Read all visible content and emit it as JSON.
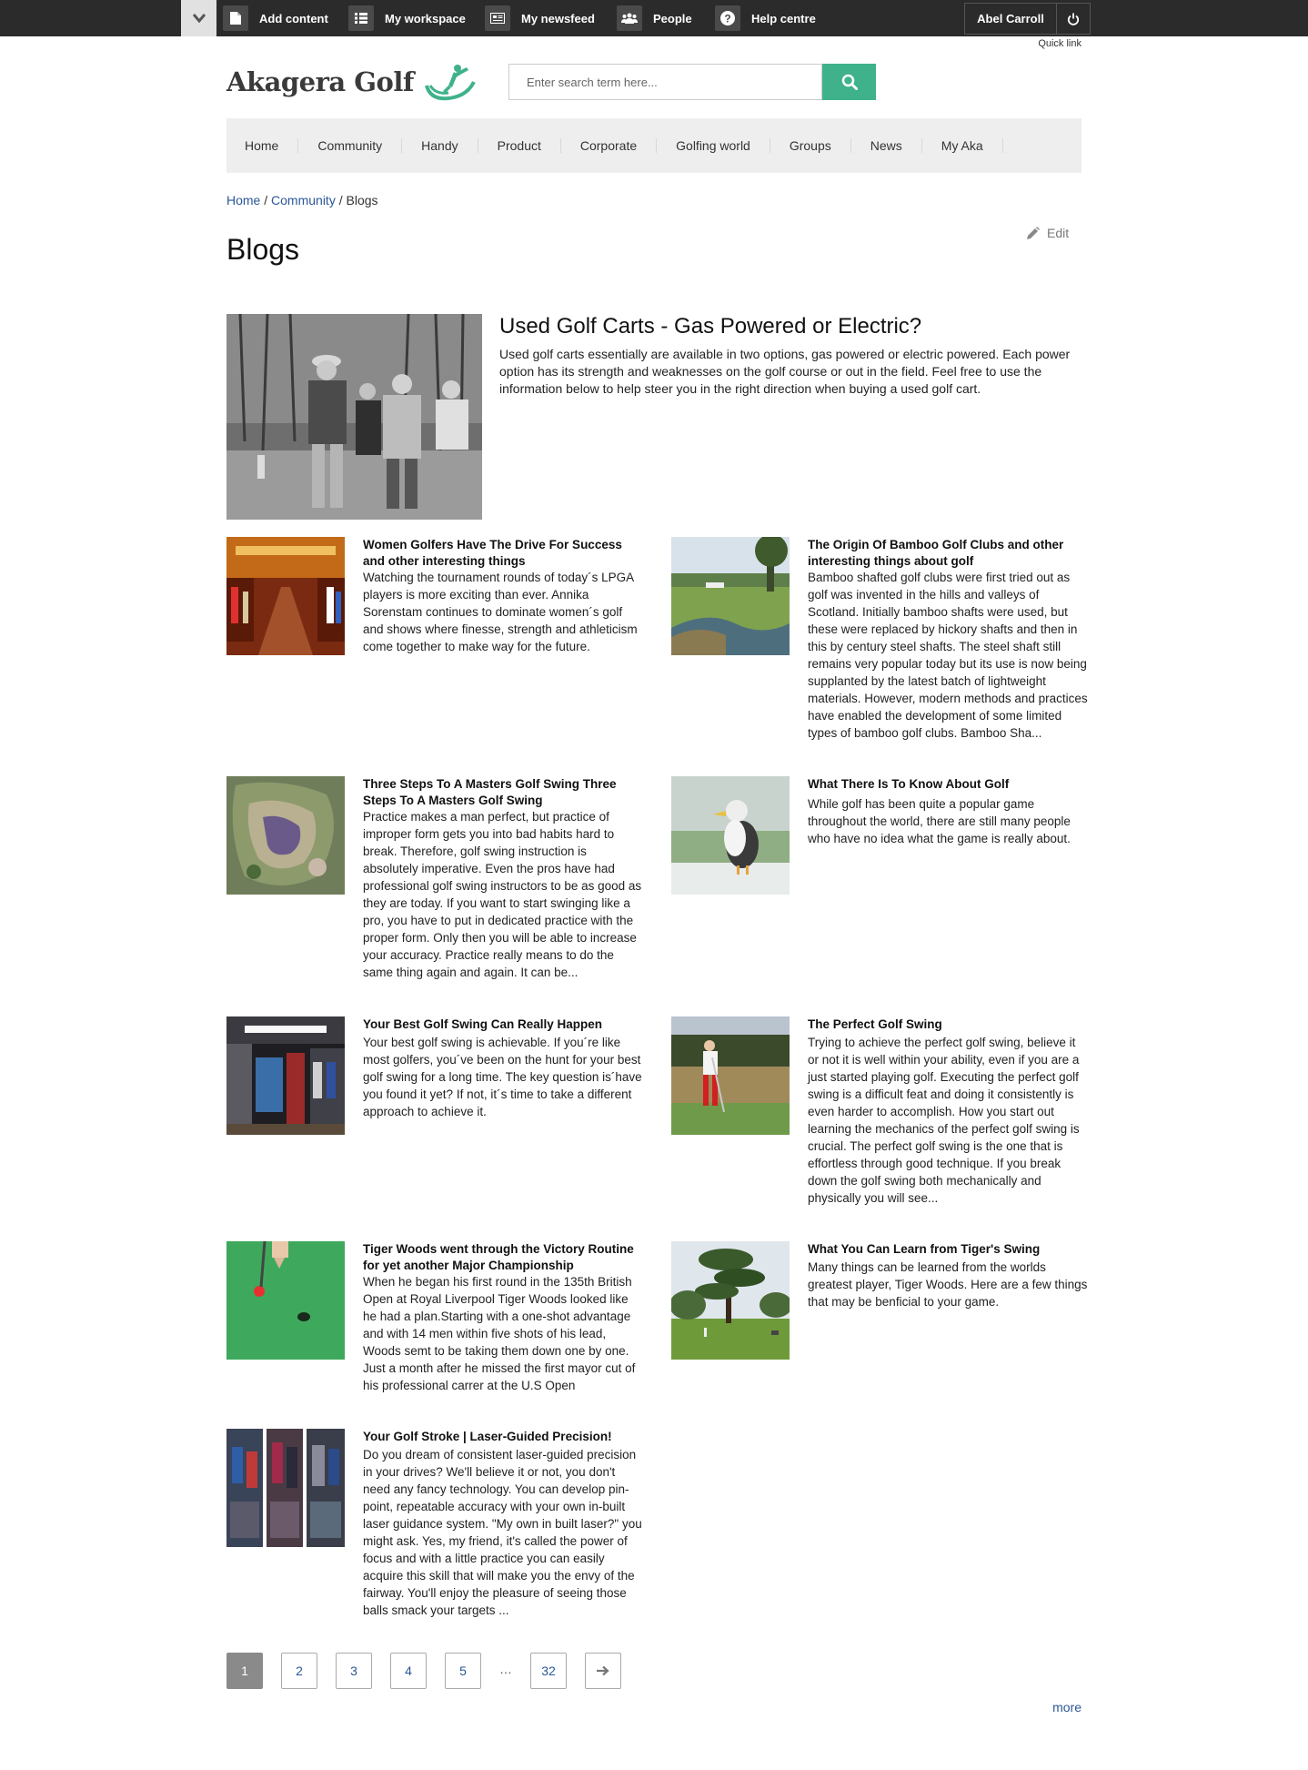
{
  "toolbar": {
    "items": [
      {
        "label": "Add content",
        "icon": "document-icon"
      },
      {
        "label": "My workspace",
        "icon": "list-icon"
      },
      {
        "label": "My newsfeed",
        "icon": "newspaper-icon"
      },
      {
        "label": "People",
        "icon": "people-icon"
      },
      {
        "label": "Help centre",
        "icon": "question-icon"
      }
    ],
    "user_name": "Abel Carroll",
    "quick_link": "Quick link"
  },
  "header": {
    "logo_text": "Akagera Golf",
    "search_placeholder": "Enter search term here...",
    "accent_color": "#3fb28b"
  },
  "nav": {
    "items": [
      "Home",
      "Community",
      "Handy",
      "Product",
      "Corporate",
      "Golfing world",
      "Groups",
      "News",
      "My Aka"
    ]
  },
  "breadcrumb": {
    "home": "Home",
    "sep1": "/",
    "community": "Community",
    "sep2": "/",
    "current": "Blogs"
  },
  "page": {
    "title": "Blogs",
    "edit_label": "Edit"
  },
  "featured": {
    "title": "Used Golf Carts - Gas Powered or Electric?",
    "text": "Used golf carts essentially are available in two options, gas powered or electric powered. Each power option has its strength and weaknesses on the golf course or out in the field. Feel free to use the information below to help steer you in the right direction when buying a used golf cart."
  },
  "posts": [
    {
      "title": "Women Golfers Have The Drive For Success and other interesting things",
      "text": "Watching the tournament rounds of today´s LPGA players is more exciting than ever. Annika Sorenstam continues to dominate women´s golf and shows where finesse, strength and athleticism come together to make way for the future."
    },
    {
      "title": "The Origin Of Bamboo Golf Clubs and other interesting things about golf",
      "text": "Bamboo shafted golf clubs were first tried out as golf was invented in the hills and valleys of Scotland. Initially bamboo shafts were used, but these were replaced by hickory shafts and then in this by century steel shafts. The steel shaft still remains very popular today but its use is now being supplanted by the latest batch of lightweight materials. However, modern methods and practices have enabled the development of some limited types of bamboo golf clubs. Bamboo Sha..."
    },
    {
      "title": "Three Steps To A Masters Golf Swing Three Steps To A Masters Golf Swing",
      "text": "Practice makes a man perfect, but practice of improper form gets you into bad habits hard to break. Therefore, golf swing instruction is absolutely imperative. Even the pros have had professional golf swing instructors to be as good as they are today. If you want to start swinging like a pro, you have to put in dedicated practice with the proper form. Only then you will be able to increase your accuracy. Practice really means to do the same thing again and again. It can be..."
    },
    {
      "title": "What There Is To Know About Golf",
      "text": "While golf has been quite a popular game throughout the world, there are still many people who have no idea what the game is really about."
    },
    {
      "title": "Your Best Golf Swing Can Really Happen",
      "text": "Your best golf swing is achievable. If you´re like most golfers, you´ve been on the hunt for your best golf swing for a long time. The key question is´have you found it yet? If not, it´s time to take a different approach to achieve it."
    },
    {
      "title": "The Perfect Golf Swing",
      "text": "Trying to achieve the perfect golf swing, believe it or not it is well within your ability, even if you are a just started playing golf. Executing the perfect golf swing is a difficult feat and doing it consistently is even harder to accomplish. How you start out learning the mechanics of the perfect golf swing is crucial. The perfect golf swing is the one that is effortless through good technique. If you break down the golf swing both mechanically and physically you will see..."
    },
    {
      "title": "Tiger Woods went through the Victory Routine for yet another Major Championship",
      "text": "When he began his first round in the 135th British Open at Royal Liverpool Tiger Woods looked like he had a plan.Starting with a one-shot advantage and with 14 men within five shots of his lead, Woods semt to be taking them down one by one. Just a month after he missed the first mayor cut of his professional carrer at the U.S Open"
    },
    {
      "title": "What You Can Learn from Tiger's Swing",
      "text": "Many things can be learned from the worlds greatest player, Tiger Woods. Here are a few things that may be benficial to your game."
    },
    {
      "title": "Your Golf Stroke | Laser-Guided Precision!",
      "text": "Do you dream of consistent laser-guided precision in your drives? We'll believe it or not, you don't need any fancy technology. You can develop pin-point, repeatable accuracy with your own in-built laser guidance system. \"My own in built laser?\" you might ask. Yes, my friend, it's called the power of focus and with a little practice you can easily acquire this skill that will make you the envy of the fairway. You'll enjoy the pleasure of seeing those balls smack your targets ..."
    }
  ],
  "pager": {
    "pages": [
      "1",
      "2",
      "3",
      "4",
      "5"
    ],
    "ellipsis": "…",
    "last": "32",
    "active": "1",
    "next_icon": "arrow-right-icon"
  },
  "more_label": "more"
}
